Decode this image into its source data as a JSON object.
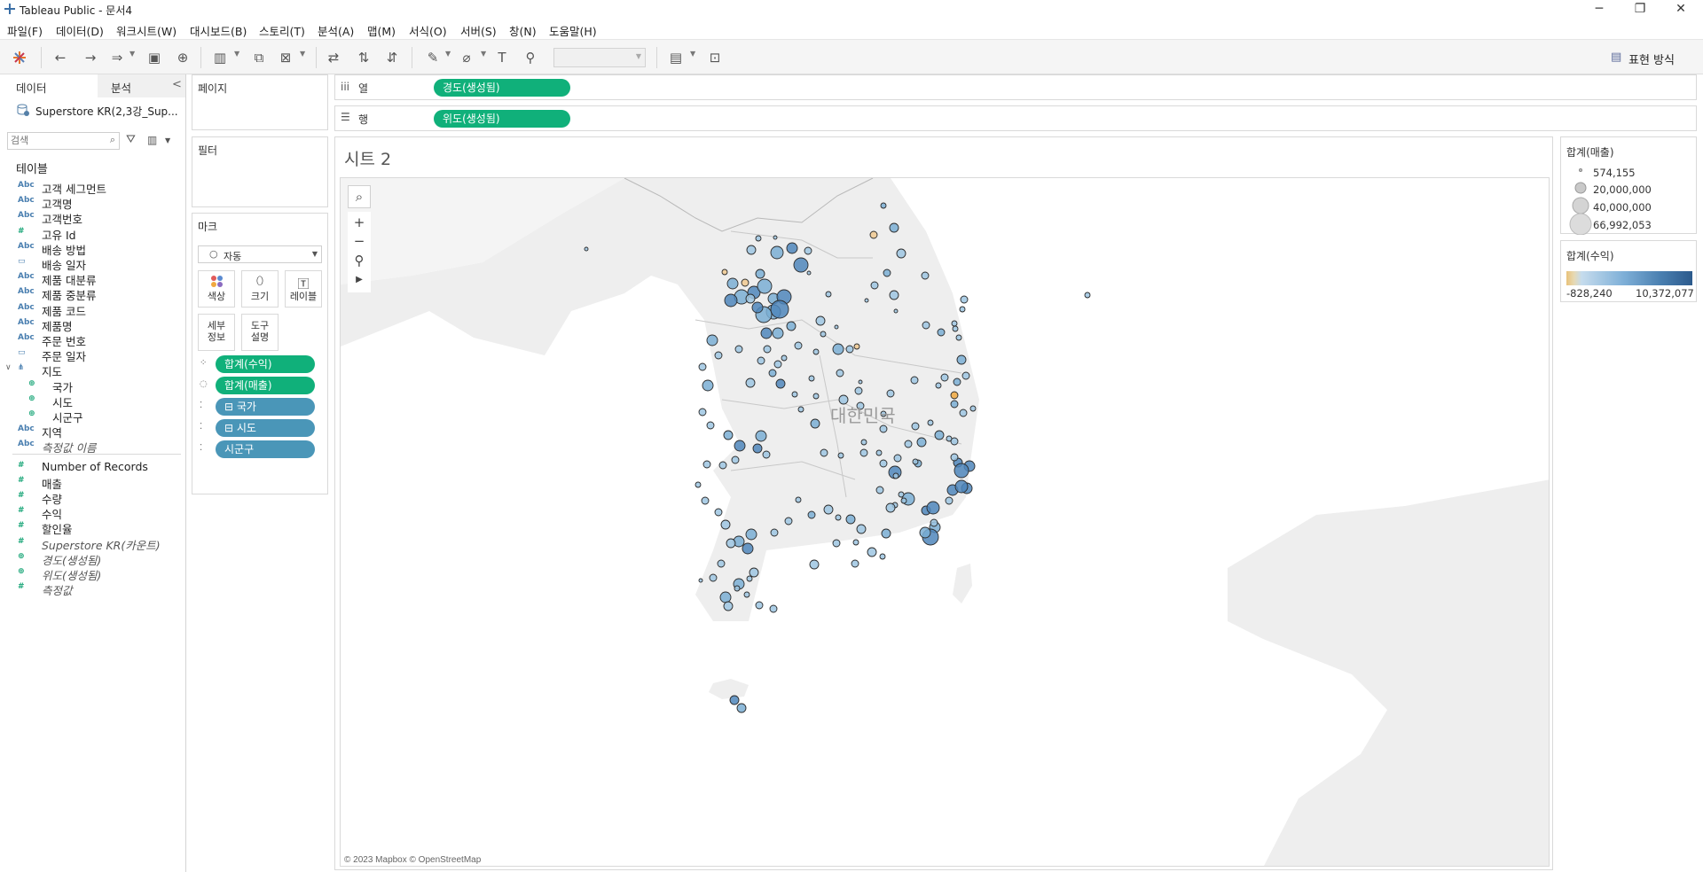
{
  "app": {
    "title": "Tableau Public - 문서4",
    "minimize": "─",
    "restore": "❐",
    "close": "✕"
  },
  "menu": [
    "파일(F)",
    "데이터(D)",
    "워크시트(W)",
    "대시보드(B)",
    "스토리(T)",
    "분석(A)",
    "맵(M)",
    "서식(O)",
    "서버(S)",
    "창(N)",
    "도움말(H)"
  ],
  "toolbar": {
    "show_me": "표현 방식"
  },
  "data_pane": {
    "tab_data": "데이터",
    "tab_analysis": "분석",
    "collapse": "<",
    "datasource": "Superstore KR(2,3강_Sup...",
    "search_placeholder": "검색",
    "section_tables": "테이블",
    "dimensions": [
      {
        "type": "Abc",
        "name": "고객 세그먼트"
      },
      {
        "type": "Abc",
        "name": "고객명"
      },
      {
        "type": "Abc",
        "name": "고객번호"
      },
      {
        "type": "#",
        "name": "고유 Id"
      },
      {
        "type": "Abc",
        "name": "배송 방법"
      },
      {
        "type": "cal",
        "name": "배송 일자"
      },
      {
        "type": "Abc",
        "name": "제품 대분류"
      },
      {
        "type": "Abc",
        "name": "제품 중분류"
      },
      {
        "type": "Abc",
        "name": "제품 코드"
      },
      {
        "type": "Abc",
        "name": "제품명"
      },
      {
        "type": "Abc",
        "name": "주문 번호"
      },
      {
        "type": "cal",
        "name": "주문 일자"
      }
    ],
    "hierarchy": {
      "name": "지도",
      "children": [
        "국가",
        "시도",
        "시군구"
      ]
    },
    "after_hierarchy": [
      {
        "type": "Abc",
        "name": "지역",
        "italic": false
      },
      {
        "type": "Abc",
        "name": "측정값 이름",
        "italic": true
      }
    ],
    "measures": [
      {
        "type": "#",
        "name": "Number of Records",
        "italic": false
      },
      {
        "type": "#",
        "name": "매출",
        "italic": false
      },
      {
        "type": "#",
        "name": "수량",
        "italic": false
      },
      {
        "type": "#",
        "name": "수익",
        "italic": false
      },
      {
        "type": "#",
        "name": "할인율",
        "italic": false
      },
      {
        "type": "#",
        "name": "Superstore KR(카운트)",
        "italic": true
      },
      {
        "type": "geo",
        "name": "경도(생성됨)",
        "italic": true
      },
      {
        "type": "geo",
        "name": "위도(생성됨)",
        "italic": true
      },
      {
        "type": "#",
        "name": "측정값",
        "italic": true
      }
    ]
  },
  "shelves": {
    "pages": "페이지",
    "filters": "필터",
    "marks": "마크",
    "mark_type": "자동",
    "columns_label": "열",
    "rows_label": "행",
    "columns_pill": "경도(생성됨)",
    "rows_pill": "위도(생성됨)",
    "mark_buttons": [
      "색상",
      "크기",
      "레이블",
      "세부\n정보",
      "도구\n설명"
    ],
    "mark_pills": [
      {
        "icon": "color",
        "label": "합계(수익)",
        "style": "green"
      },
      {
        "icon": "size",
        "label": "합계(매출)",
        "style": "green"
      },
      {
        "icon": "detail",
        "label": "⊟ 국가",
        "style": "blue"
      },
      {
        "icon": "detail",
        "label": "⊟ 시도",
        "style": "blue"
      },
      {
        "icon": "detail",
        "label": "시군구",
        "style": "blue"
      }
    ]
  },
  "viz": {
    "sheet_title": "시트 2",
    "country_label": "대한민국",
    "attribution": "© 2023 Mapbox © OpenStreetMap"
  },
  "legend_size": {
    "title": "합계(매출)",
    "items": [
      "574,155",
      "20,000,000",
      "40,000,000",
      "66,992,053"
    ]
  },
  "legend_color": {
    "title": "합계(수익)",
    "min": "-828,240",
    "max": "10,372,077",
    "color_low": "#e8c27a",
    "color_high": "#2c5a8c"
  }
}
